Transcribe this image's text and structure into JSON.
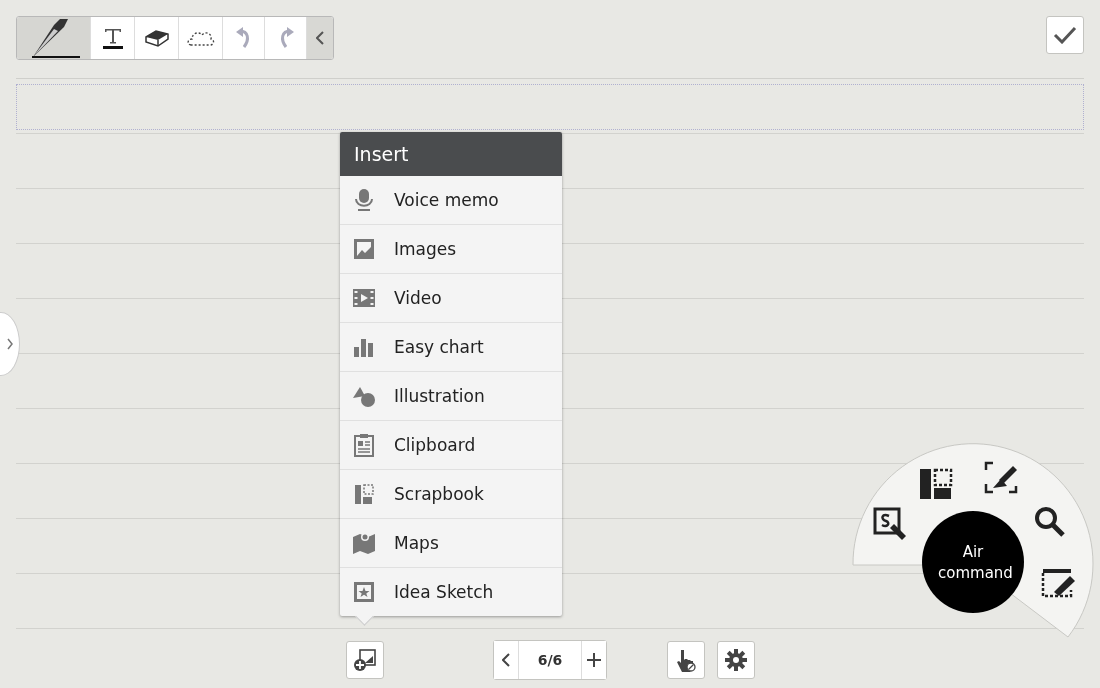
{
  "toolbar": {
    "tools": [
      {
        "kind": "pen",
        "selected": true
      },
      {
        "kind": "text",
        "selected": false
      },
      {
        "kind": "eraser",
        "selected": false
      },
      {
        "kind": "lasso",
        "selected": false
      },
      {
        "kind": "undo",
        "selected": false
      },
      {
        "kind": "redo",
        "selected": false
      }
    ]
  },
  "insert_menu": {
    "title": "Insert",
    "items": [
      {
        "kind": "voice",
        "label": "Voice memo"
      },
      {
        "kind": "image",
        "label": "Images"
      },
      {
        "kind": "video",
        "label": "Video"
      },
      {
        "kind": "chart",
        "label": "Easy chart"
      },
      {
        "kind": "illustration",
        "label": "Illustration"
      },
      {
        "kind": "clipboard",
        "label": "Clipboard"
      },
      {
        "kind": "scrapbook",
        "label": "Scrapbook"
      },
      {
        "kind": "maps",
        "label": "Maps"
      },
      {
        "kind": "idea",
        "label": "Idea Sketch"
      }
    ]
  },
  "page_indicator": "6/6",
  "air_command": {
    "label": "Air command"
  }
}
